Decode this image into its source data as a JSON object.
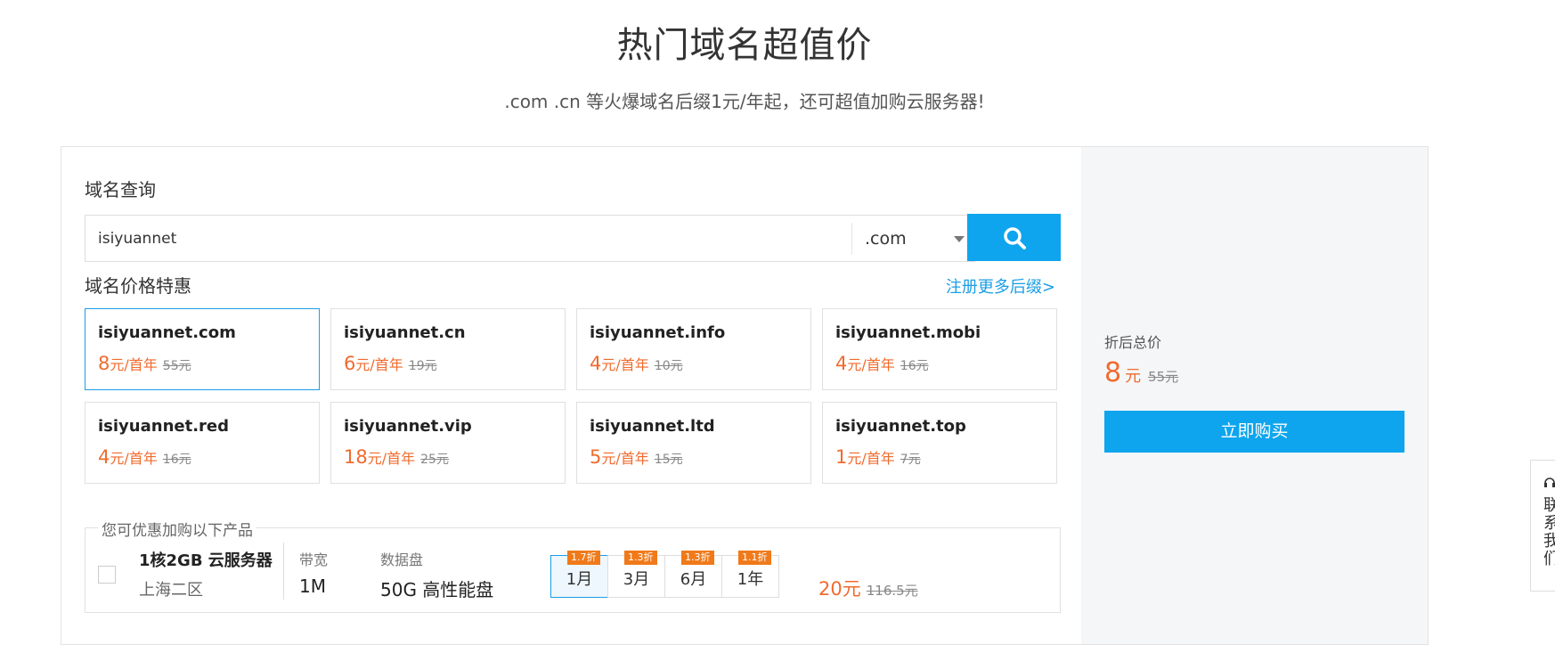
{
  "hero": {
    "title": "热门域名超值价",
    "subtitle": ".com .cn 等火爆域名后缀1元/年起，还可超值加购云服务器!"
  },
  "search": {
    "section_label": "域名查询",
    "value": "isiyuannet",
    "suffix": ".com",
    "button_icon": "search-icon"
  },
  "offers": {
    "section_label": "域名价格特惠",
    "more_link": "注册更多后缀>",
    "unit": "元/首年",
    "cards": [
      {
        "name": "isiyuannet.com",
        "price": "8",
        "old": "55元",
        "selected": true
      },
      {
        "name": "isiyuannet.cn",
        "price": "6",
        "old": "19元"
      },
      {
        "name": "isiyuannet.info",
        "price": "4",
        "old": "10元"
      },
      {
        "name": "isiyuannet.mobi",
        "price": "4",
        "old": "16元"
      },
      {
        "name": "isiyuannet.red",
        "price": "4",
        "old": "16元"
      },
      {
        "name": "isiyuannet.vip",
        "price": "18",
        "old": "25元"
      },
      {
        "name": "isiyuannet.ltd",
        "price": "5",
        "old": "15元"
      },
      {
        "name": "isiyuannet.top",
        "price": "1",
        "old": "7元"
      }
    ]
  },
  "addon": {
    "legend": "您可优惠加购以下产品",
    "title": "1核2GB 云服务器",
    "region": "上海二区",
    "bandwidth_label": "带宽",
    "bandwidth_value": "1M",
    "disk_label": "数据盘",
    "disk_value": "50G  高性能盘",
    "periods": [
      {
        "label": "1月",
        "discount": "1.7折",
        "selected": true
      },
      {
        "label": "3月",
        "discount": "1.3折"
      },
      {
        "label": "6月",
        "discount": "1.3折"
      },
      {
        "label": "1年",
        "discount": "1.1折"
      }
    ],
    "price": "20元",
    "old_price": "116.5元"
  },
  "summary": {
    "label": "折后总价",
    "price": "8",
    "unit": "元",
    "old_price": "55元",
    "buy_label": "立即购买"
  },
  "side_widget": {
    "icon": "headset-icon",
    "text": "联系我们"
  },
  "colors": {
    "accent": "#0ea5ee",
    "price": "#f06b2e",
    "discount_badge": "#f07a1a"
  }
}
